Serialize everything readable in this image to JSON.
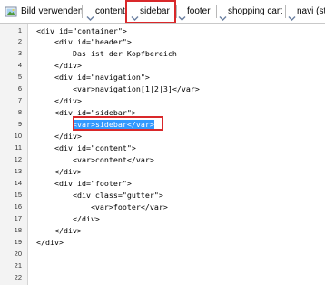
{
  "toolbar": {
    "items": [
      {
        "label": "Bild verwenden",
        "icon": "image-icon"
      },
      {
        "label": "content",
        "icon": "chevron-down-icon"
      },
      {
        "label": "sidebar",
        "icon": "chevron-down-icon"
      },
      {
        "label": "footer",
        "icon": "chevron-down-icon"
      },
      {
        "label": "shopping cart",
        "icon": "chevron-down-icon"
      },
      {
        "label": "navi (st",
        "icon": "chevron-down-icon"
      }
    ],
    "highlight_color": "#d9282a"
  },
  "editor": {
    "line_numbers": [
      "1",
      "2",
      "3",
      "4",
      "5",
      "6",
      "7",
      "8",
      "9",
      "10",
      "11",
      "12",
      "13",
      "14",
      "15",
      "16",
      "17",
      "18",
      "19",
      "20",
      "21",
      "22"
    ],
    "lines": [
      "<div id=\"container\">",
      "    <div id=\"header\">",
      "        Das ist der Kopfbereich",
      "    </div>",
      "    <div id=\"navigation\">",
      "        <var>navigation[1|2|3]</var>",
      "    </div>",
      "    <div id=\"sidebar\">",
      "        <var>sidebar</var>",
      "    </div>",
      "    <div id=\"content\">",
      "        <var>content</var>",
      "    </div>",
      "    <div id=\"footer\">",
      "        <div class=\"gutter\">",
      "            <var>footer</var>",
      "        </div>",
      "    </div>",
      "</div>",
      "",
      "",
      ""
    ],
    "selected_text": "<var>sidebar</var>",
    "selection_color": "#3399ff"
  }
}
